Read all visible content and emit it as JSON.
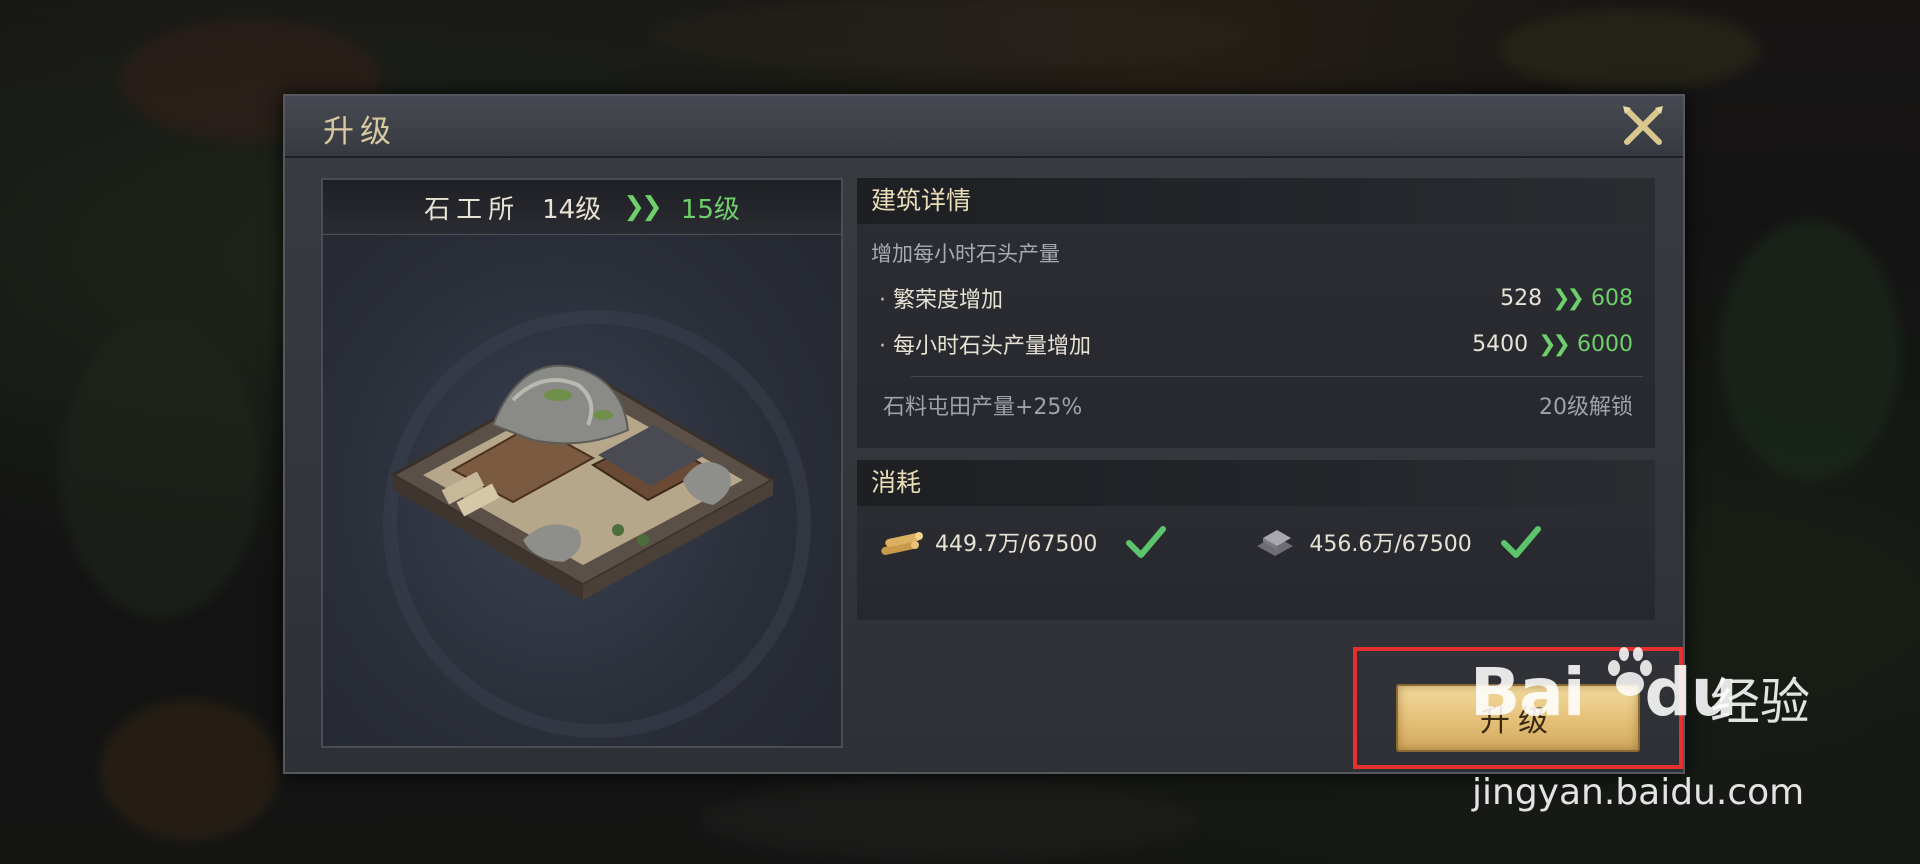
{
  "dialog": {
    "title": "升级",
    "close_icon": "close-x-icon"
  },
  "building": {
    "name": "石工所",
    "current_level": "14级",
    "next_level": "15级",
    "arrow": "»"
  },
  "details": {
    "header": "建筑详情",
    "description": "增加每小时石头产量",
    "stats": [
      {
        "label": "繁荣度增加",
        "old": "528",
        "new": "608"
      },
      {
        "label": "每小时石头产量增加",
        "old": "5400",
        "new": "6000"
      }
    ],
    "unlock": {
      "label": "石料屯田产量+25%",
      "requirement": "20级解锁"
    }
  },
  "cost": {
    "header": "消耗",
    "items": [
      {
        "icon": "wood-icon",
        "amount": "449.7万/67500"
      },
      {
        "icon": "iron-icon",
        "amount": "456.6万/67500"
      }
    ]
  },
  "upgrade_button": {
    "label": "升级"
  },
  "watermark": {
    "logo": "Bai",
    "logo_end": "du",
    "cn": "经验",
    "url": "jingyan.baidu.com"
  },
  "colors": {
    "accent_green": "#6fcf6a",
    "gold_button": "#e6c27a",
    "highlight_red": "#e53030"
  }
}
